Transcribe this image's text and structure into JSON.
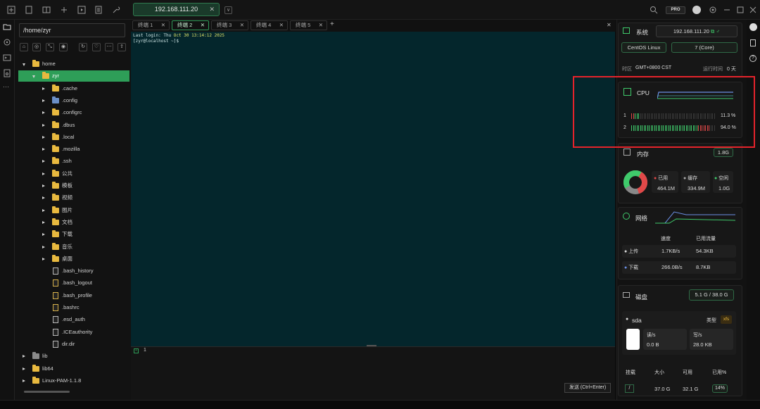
{
  "titlebar": {
    "host_tab": "192.168.111.20",
    "tab_close": "✕",
    "dropdown": "∨",
    "badge": "PRO"
  },
  "sidebar": {
    "path": "/home/zyr"
  },
  "tree": [
    {
      "label": "home",
      "depth": 0,
      "kind": "folder",
      "expanded": true
    },
    {
      "label": "zyr",
      "depth": 1,
      "kind": "folder",
      "expanded": true,
      "selected": true
    },
    {
      "label": ".cache",
      "depth": 2,
      "kind": "folder"
    },
    {
      "label": ".config",
      "depth": 2,
      "kind": "folder-special"
    },
    {
      "label": ".configrc",
      "depth": 2,
      "kind": "folder"
    },
    {
      "label": ".dbus",
      "depth": 2,
      "kind": "folder"
    },
    {
      "label": ".local",
      "depth": 2,
      "kind": "folder"
    },
    {
      "label": ".mozilla",
      "depth": 2,
      "kind": "folder"
    },
    {
      "label": ".ssh",
      "depth": 2,
      "kind": "folder"
    },
    {
      "label": "公共",
      "depth": 2,
      "kind": "folder"
    },
    {
      "label": "模板",
      "depth": 2,
      "kind": "folder"
    },
    {
      "label": "视频",
      "depth": 2,
      "kind": "folder"
    },
    {
      "label": "图片",
      "depth": 2,
      "kind": "folder"
    },
    {
      "label": "文档",
      "depth": 2,
      "kind": "folder"
    },
    {
      "label": "下载",
      "depth": 2,
      "kind": "folder"
    },
    {
      "label": "音乐",
      "depth": 2,
      "kind": "folder"
    },
    {
      "label": "桌面",
      "depth": 2,
      "kind": "folder"
    },
    {
      "label": ".bash_history",
      "depth": 2,
      "kind": "file"
    },
    {
      "label": ".bash_logout",
      "depth": 2,
      "kind": "script"
    },
    {
      "label": ".bash_profile",
      "depth": 2,
      "kind": "script"
    },
    {
      "label": ".bashrc",
      "depth": 2,
      "kind": "script"
    },
    {
      "label": ".esd_auth",
      "depth": 2,
      "kind": "file"
    },
    {
      "label": ".ICEauthority",
      "depth": 2,
      "kind": "file"
    },
    {
      "label": "dir.dir",
      "depth": 2,
      "kind": "file"
    },
    {
      "label": "lib",
      "depth": 0,
      "kind": "folder-gray"
    },
    {
      "label": "lib64",
      "depth": 0,
      "kind": "folder"
    },
    {
      "label": "Linux-PAM-1.1.8",
      "depth": 0,
      "kind": "folder"
    }
  ],
  "terminal": {
    "tabs": [
      {
        "label": "终端 1",
        "close": "✕"
      },
      {
        "label": "终端 2",
        "close": "✕",
        "active": true
      },
      {
        "label": "终端 3",
        "close": "✕"
      },
      {
        "label": "终端 4",
        "close": "✕"
      },
      {
        "label": "终端 5",
        "close": "✕"
      }
    ],
    "add": "+",
    "close_all": "✕",
    "line1_a": "Last login: Thu ",
    "line1_b": "Oct 30 13:14:12 2025",
    "line2": "[zyr@localhost ~]$",
    "input_line": "1",
    "send_label": "发送 (Ctrl+Enter)"
  },
  "system": {
    "title": "系统",
    "ip": "192.168.111.20",
    "os": "CentOS Linux",
    "cores": "7 (Core)",
    "tz_label": "时区",
    "tz_value": "GMT+0800 CST",
    "uptime_label": "运行时间",
    "uptime_value": "0 天"
  },
  "cpu": {
    "title": "CPU",
    "cores": [
      {
        "id": "1",
        "usage": "11.3 %",
        "fraction": 0.113
      },
      {
        "id": "2",
        "usage": "94.0 %",
        "fraction": 0.94
      }
    ]
  },
  "memory": {
    "title": "内存",
    "total": "1.8G",
    "used_label": "已用",
    "used": "464.1M",
    "cache_label": "缓存",
    "cache": "334.9M",
    "free_label": "空闲",
    "free": "1.0G"
  },
  "network": {
    "title": "网络",
    "speed_header": "速度",
    "traffic_header": "已用流量",
    "up_label": "上传",
    "up_speed": "1.7KB/s",
    "up_total": "54.3KB",
    "down_label": "下载",
    "down_speed": "266.0B/s",
    "down_total": "8.7KB"
  },
  "disk": {
    "title": "磁盘",
    "summary": "5.1 G / 38.0 G",
    "device": "sda",
    "type_label": "类型",
    "type_value": "xfs",
    "read_label": "读/s",
    "read": "0.0 B",
    "write_label": "写/s",
    "write": "28.0 KB",
    "headers": [
      "挂载",
      "大小",
      "可用",
      "已用%"
    ],
    "row": {
      "mount": "/",
      "size": "37.0 G",
      "avail": "32.1 G",
      "used_pct": "14%"
    }
  },
  "colors": {
    "accent": "#2e9e58",
    "terminal_bg": "#04262c",
    "highlight": "#e5232b"
  }
}
